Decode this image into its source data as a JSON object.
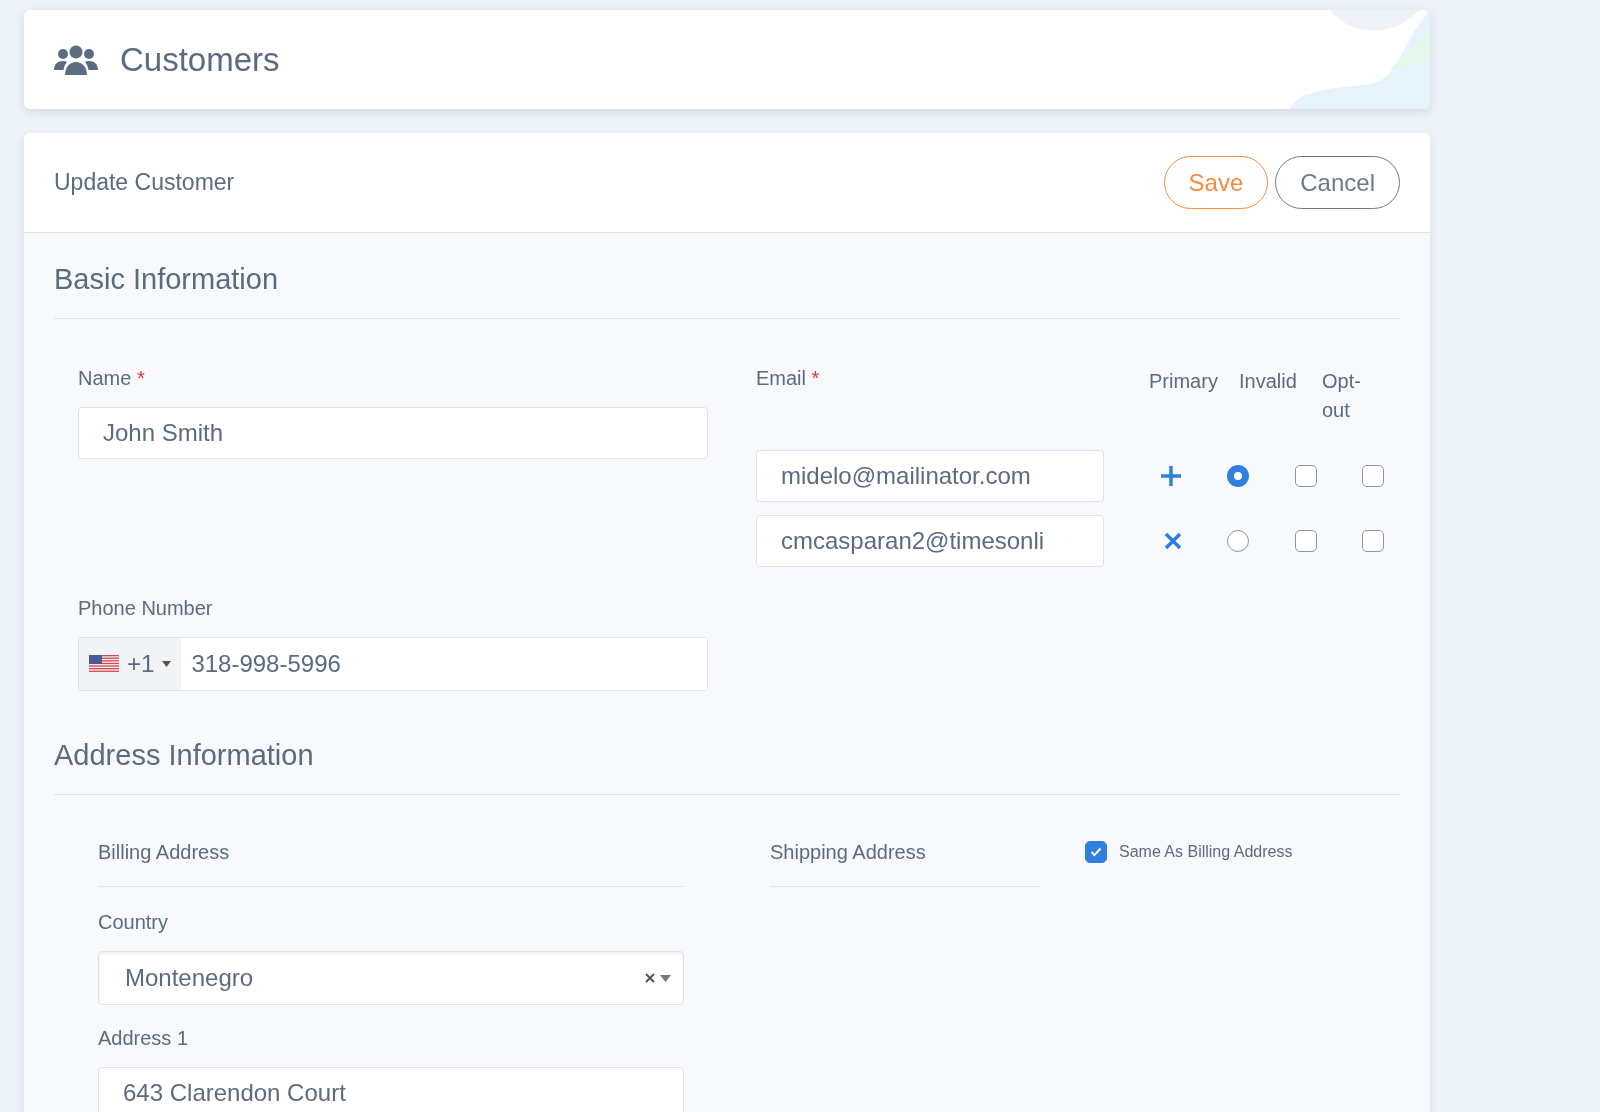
{
  "header": {
    "title": "Customers"
  },
  "form": {
    "title": "Update Customer",
    "buttons": [
      {
        "kind": "primary",
        "label": "Save"
      },
      {
        "kind": "secondary",
        "label": "Cancel"
      }
    ]
  },
  "basic": {
    "heading": "Basic Information",
    "name": {
      "label": "Name",
      "required_mark": "*",
      "value": "John Smith"
    },
    "email": {
      "label": "Email",
      "required_mark": "*",
      "columns": [
        "Primary",
        "Invalid",
        "Opt-out"
      ],
      "rows": [
        {
          "value": "midelo@mailinator.com",
          "kind": "add",
          "selected": true,
          "invalid": false,
          "opt_out": false
        },
        {
          "value": "cmcasparan2@timesonli",
          "kind": "remove",
          "selected": false,
          "invalid": false,
          "opt_out": false
        }
      ]
    },
    "phone": {
      "label": "Phone Number",
      "dial_code": "+1",
      "value": "318-998-5996"
    }
  },
  "address": {
    "heading": "Address Information",
    "billing": {
      "title": "Billing Address",
      "country_label": "Country",
      "country": "Montenegro",
      "address1_label": "Address 1",
      "address1": "643 Clarendon Court"
    },
    "shipping": {
      "title": "Shipping Address",
      "same_as_billing": {
        "label": "Same As Billing Address",
        "checked": true
      }
    }
  }
}
